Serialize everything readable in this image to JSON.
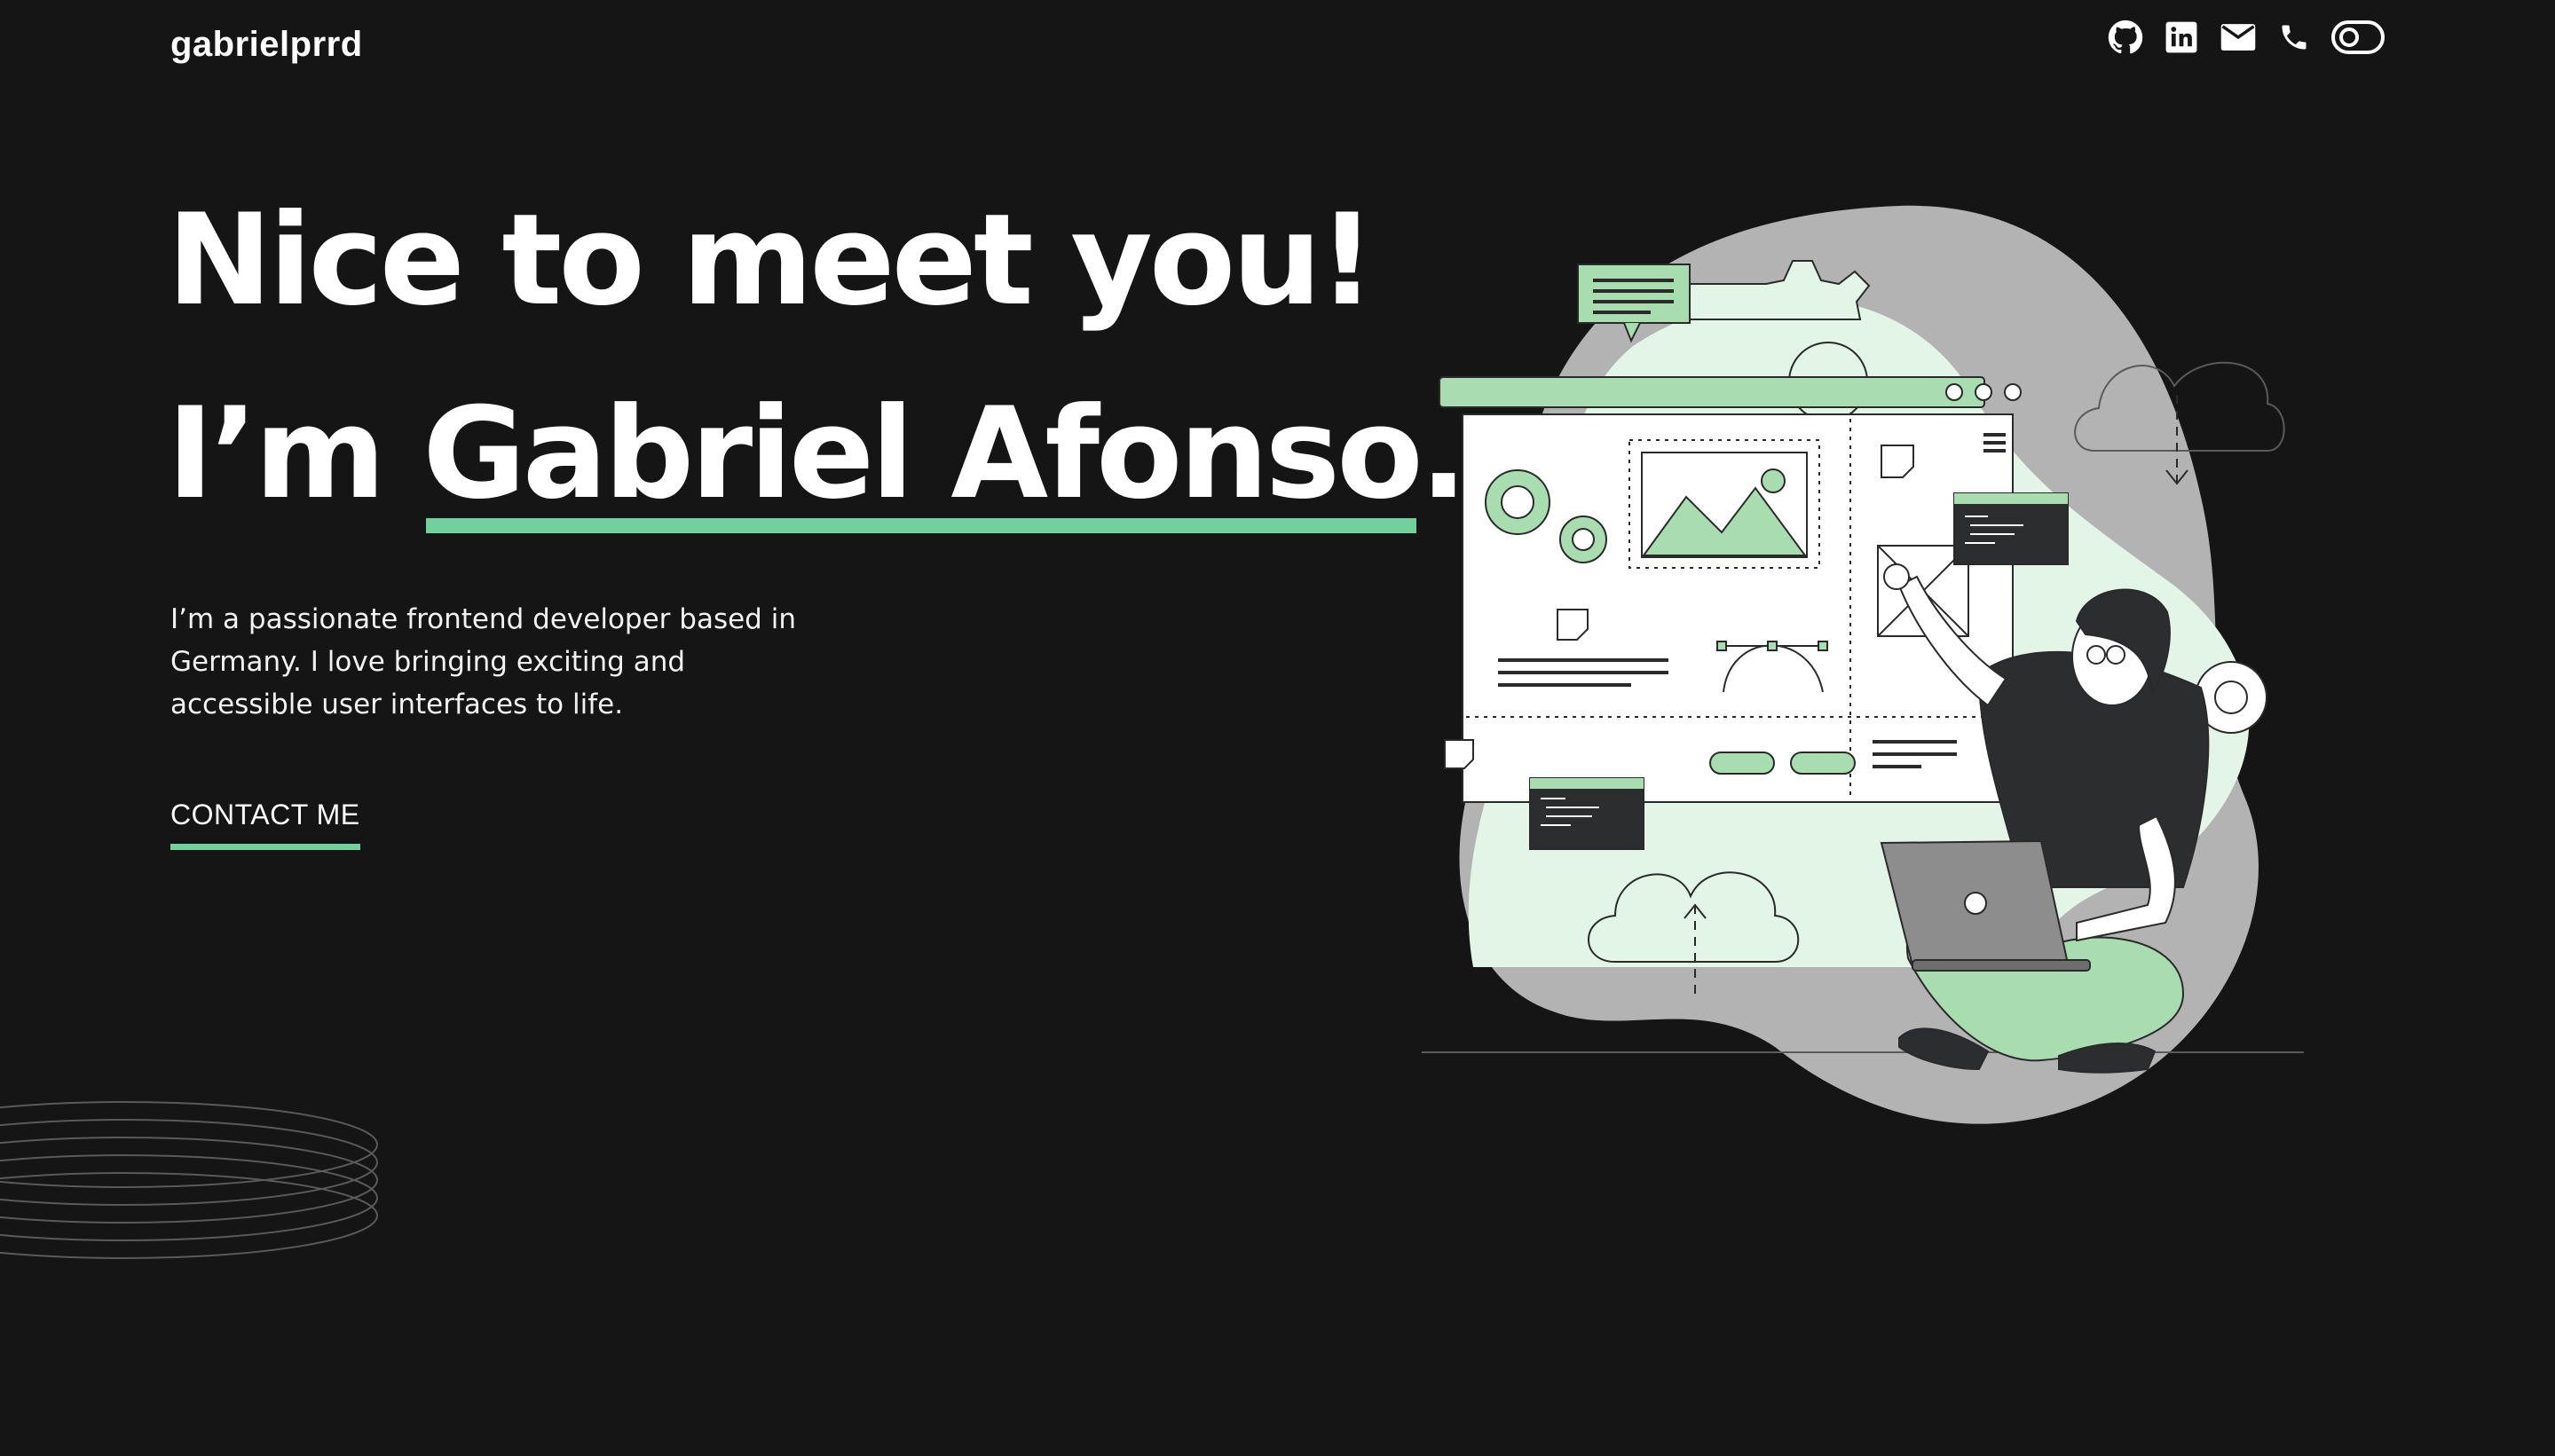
{
  "header": {
    "logo": "gabrielprrd",
    "icons": [
      "github-icon",
      "linkedin-icon",
      "mail-icon",
      "phone-icon",
      "theme-toggle-icon"
    ]
  },
  "hero": {
    "line1": "Nice to meet you!",
    "line2_prefix": "I’m ",
    "name": "Gabriel Afonso",
    "line2_suffix": ".",
    "intro": "I’m a passionate frontend developer based in Germany. I love bringing exciting and accessible user interfaces to life.",
    "cta": "CONTACT ME"
  },
  "colors": {
    "background": "#151515",
    "accent": "#70d19c",
    "text": "#ffffff"
  }
}
